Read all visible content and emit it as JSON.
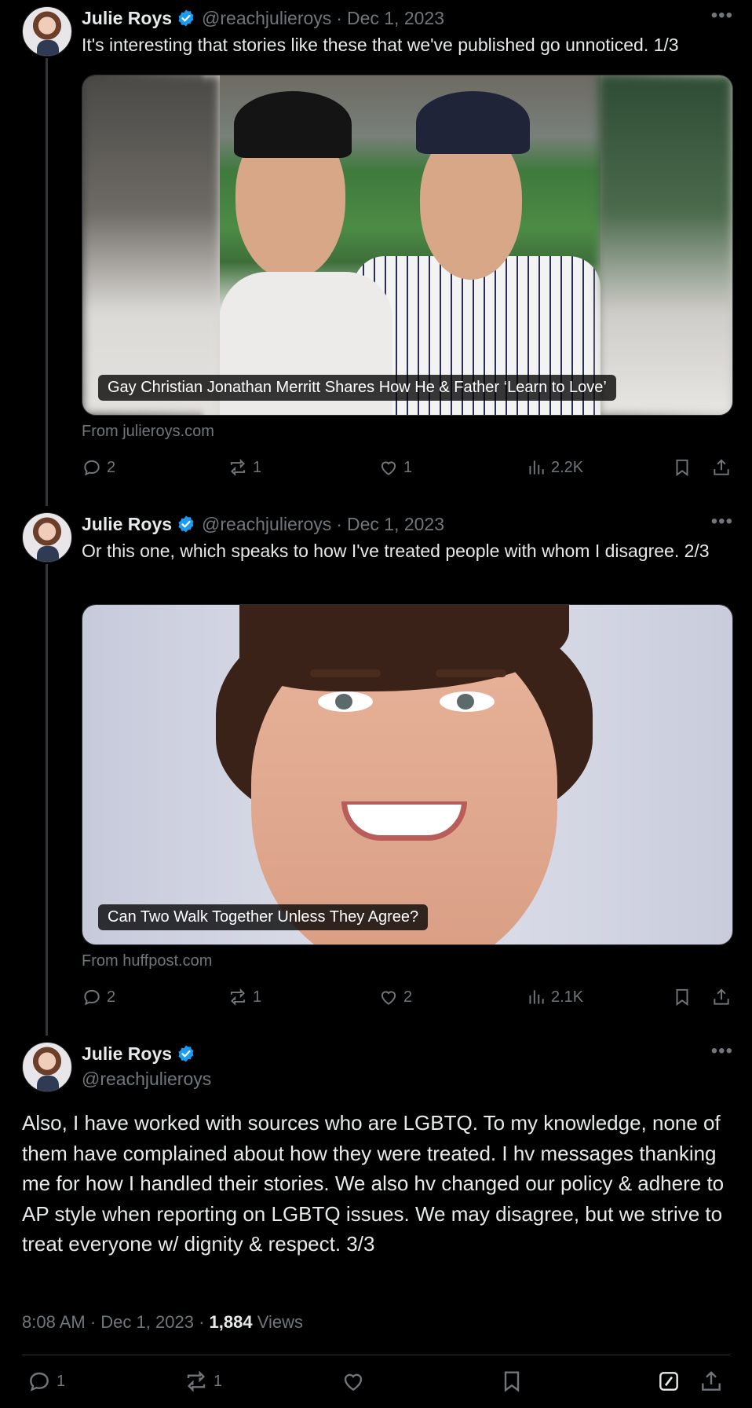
{
  "tweets": [
    {
      "name": "Julie Roys",
      "handle": "@reachjulieroys",
      "separator": "·",
      "date": "Dec 1, 2023",
      "text": "It's interesting that stories like these that we've published go unnoticed. 1/3",
      "card": {
        "caption": "Gay Christian Jonathan Merritt Shares How He & Father ‘Learn to Love’",
        "source": "From julieroys.com"
      },
      "stats": {
        "replies": "2",
        "reposts": "1",
        "likes": "1",
        "views": "2.2K"
      }
    },
    {
      "name": "Julie Roys",
      "handle": "@reachjulieroys",
      "separator": "·",
      "date": "Dec 1, 2023",
      "text": "Or this one, which speaks to how I've treated people with whom I disagree. 2/3",
      "card": {
        "caption": "Can Two Walk Together Unless They Agree?",
        "source": "From huffpost.com"
      },
      "stats": {
        "replies": "2",
        "reposts": "1",
        "likes": "2",
        "views": "2.1K"
      }
    }
  ],
  "main_tweet": {
    "name": "Julie Roys",
    "handle": "@reachjulieroys",
    "text": "Also, I have worked with sources who are LGBTQ. To my knowledge, none of them have complained about how they were treated. I hv messages thanking me for how I handled their stories. We also hv changed our policy & adhere to AP style when reporting on LGBTQ issues. We may disagree, but we strive to treat everyone w/ dignity & respect. 3/3",
    "time": "8:08 AM",
    "separator": "·",
    "date": "Dec 1, 2023",
    "views_count": "1,884",
    "views_label": "Views",
    "stats": {
      "replies": "1",
      "reposts": "1"
    }
  },
  "more_glyph": "•••",
  "colors": {
    "background": "#000000",
    "text": "#e7e9ea",
    "muted": "#71767b",
    "verified": "#1d9bf0",
    "border": "#2f3336"
  },
  "icons": [
    "reply-icon",
    "repost-icon",
    "like-icon",
    "views-icon",
    "bookmark-icon",
    "share-icon",
    "grok-icon",
    "verified-badge-icon",
    "more-icon"
  ]
}
